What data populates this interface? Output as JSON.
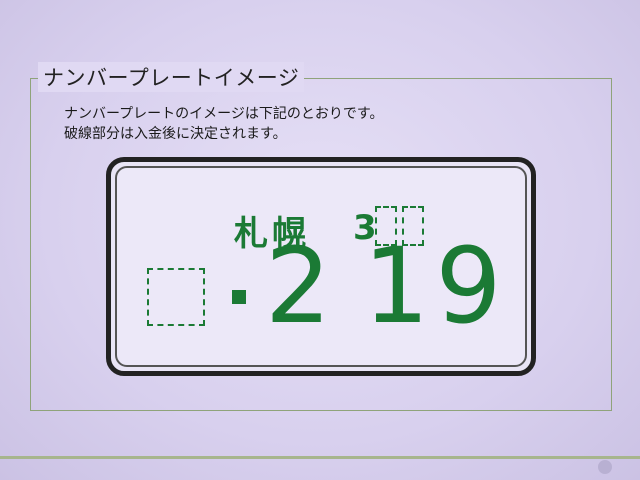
{
  "section": {
    "legend": "ナンバープレートイメージ",
    "note_line1": "ナンバープレートのイメージは下記のとおりです。",
    "note_line2": "破線部分は入金後に決定されます。"
  },
  "plate": {
    "region": "札幌",
    "class_prefix": "3",
    "number_first": "2",
    "number_rest": "19",
    "text_color": "#1b7a35"
  }
}
